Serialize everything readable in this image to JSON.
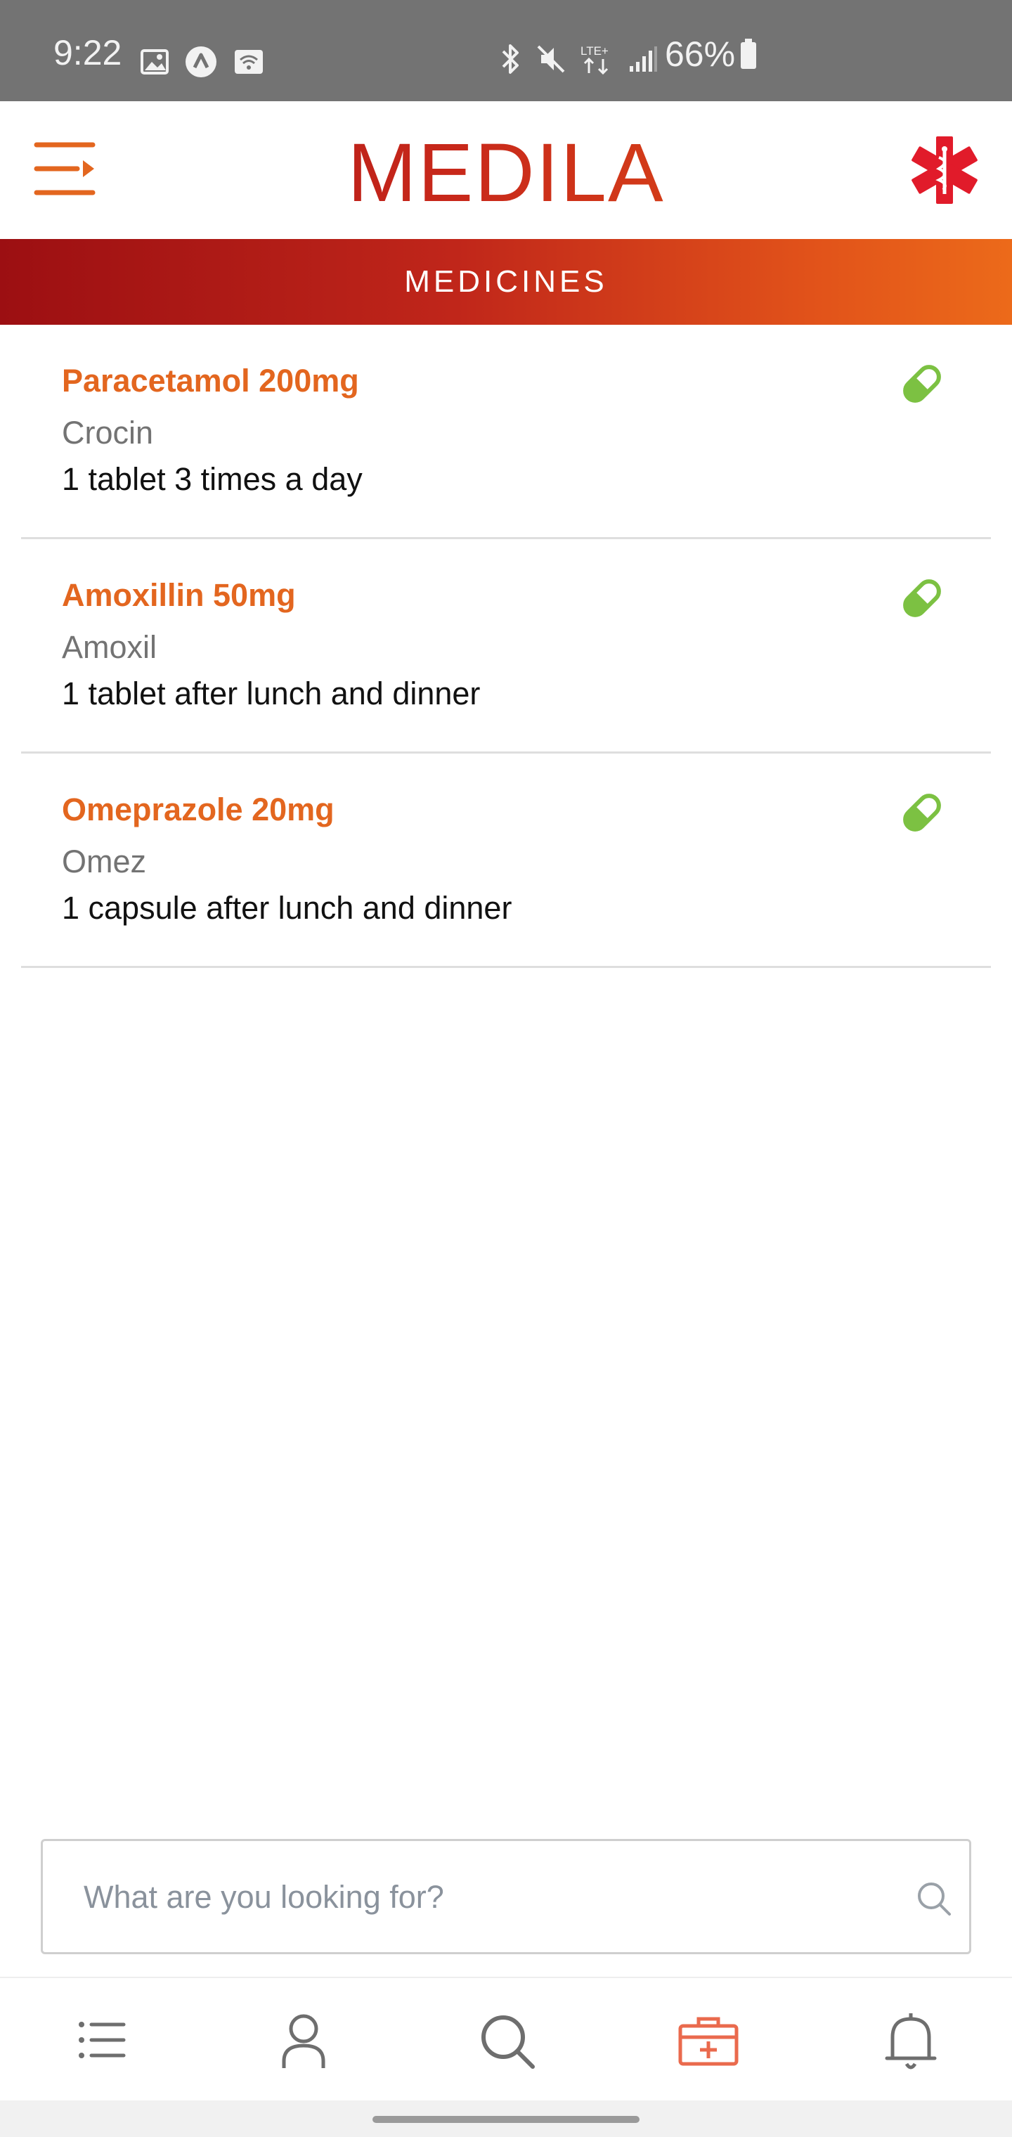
{
  "status_bar": {
    "time": "9:22",
    "battery": "66%",
    "icons_left": [
      "gallery-icon",
      "app-notification-icon",
      "wifi-hotspot-icon"
    ],
    "icons_right": [
      "bluetooth-icon",
      "mute-icon",
      "lte-icon",
      "signal-icon"
    ]
  },
  "app_bar": {
    "title": "MEDILA",
    "menu_icon": "menu-icon",
    "logo_icon": "medical-star-of-life-icon",
    "accent_color": "#e3661f",
    "brand_red": "#a3121a"
  },
  "section": {
    "title": "MEDICINES"
  },
  "medicines": [
    {
      "name": "Paracetamol 200mg",
      "brand": "Crocin",
      "dose": "1 tablet 3 times a day",
      "icon": "pill-icon"
    },
    {
      "name": "Amoxillin 50mg",
      "brand": "Amoxil",
      "dose": "1 tablet after lunch and dinner",
      "icon": "pill-icon"
    },
    {
      "name": "Omeprazole 20mg",
      "brand": "Omez",
      "dose": "1 capsule after lunch and dinner",
      "icon": "pill-icon"
    }
  ],
  "search": {
    "placeholder": "What are you looking for?",
    "value": ""
  },
  "bottom_nav": {
    "items": [
      {
        "id": "list",
        "icon": "list-icon",
        "active": false
      },
      {
        "id": "profile",
        "icon": "user-icon",
        "active": false
      },
      {
        "id": "search",
        "icon": "search-icon",
        "active": false
      },
      {
        "id": "medicines",
        "icon": "medical-kit-icon",
        "active": true
      },
      {
        "id": "notifications",
        "icon": "bell-icon",
        "active": false
      }
    ],
    "active_color": "#ea6a4d",
    "inactive_color": "#6e6e6e"
  },
  "colors": {
    "pill_green": "#7cc142",
    "status_bar_bg": "#737373",
    "divider": "#dedede"
  }
}
